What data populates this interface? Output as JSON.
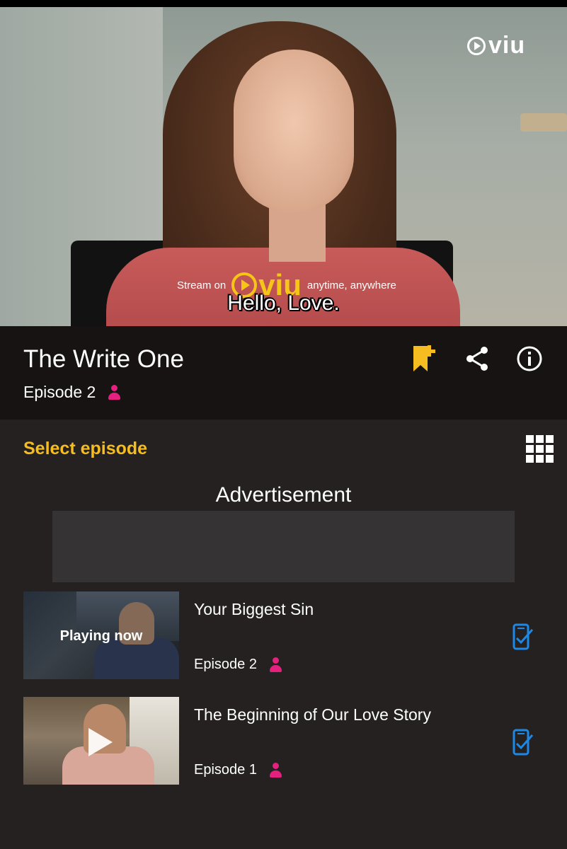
{
  "video": {
    "watermark": "viu",
    "promo_prefix": "Stream on",
    "promo_logo": "viu",
    "promo_suffix": "anytime, anywhere",
    "subtitle": "Hello, Love."
  },
  "show": {
    "title": "The Write One",
    "episode": "Episode 2",
    "icons": [
      "bookmark-add-icon",
      "share-icon",
      "info-icon"
    ]
  },
  "episodes_section": {
    "heading": "Select episode",
    "ad_label": "Advertisement",
    "items": [
      {
        "title": "Your Biggest Sin",
        "episode": "Episode 2",
        "overlay": "Playing now"
      },
      {
        "title": "The Beginning of Our Love Story",
        "episode": "Episode 1"
      }
    ]
  },
  "colors": {
    "accent_yellow": "#f5bd1f",
    "pink": "#e5207f",
    "blue": "#1e88e5",
    "background": "#242120",
    "title_bar": "#161312"
  }
}
